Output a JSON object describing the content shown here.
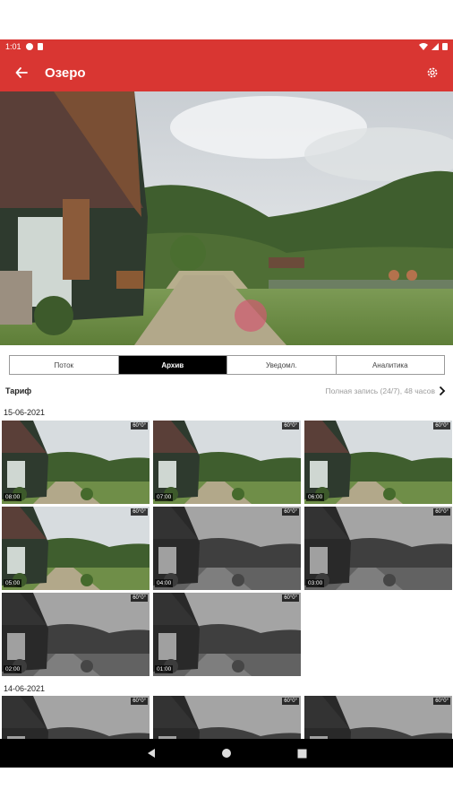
{
  "status_bar": {
    "time": "1:01"
  },
  "app_bar": {
    "title": "Озеро"
  },
  "tabs": [
    {
      "label": "Поток",
      "active": false
    },
    {
      "label": "Архив",
      "active": true
    },
    {
      "label": "Уведомл.",
      "active": false
    },
    {
      "label": "Аналитика",
      "active": false
    }
  ],
  "tariff": {
    "label": "Тариф",
    "value": "Полная запись (24/7), 48 часов"
  },
  "groups": [
    {
      "date": "15-06-2021",
      "thumbs": [
        {
          "time": "08:00",
          "badge": "60°0°",
          "night": false
        },
        {
          "time": "07:00",
          "badge": "60°0°",
          "night": false
        },
        {
          "time": "06:00",
          "badge": "60°0°",
          "night": false
        },
        {
          "time": "05:00",
          "badge": "60°0°",
          "night": false
        },
        {
          "time": "04:00",
          "badge": "60°0°",
          "night": true
        },
        {
          "time": "03:00",
          "badge": "60°0°",
          "night": true
        },
        {
          "time": "02:00",
          "badge": "60°0°",
          "night": true
        },
        {
          "time": "01:00",
          "badge": "60°0°",
          "night": true
        }
      ]
    },
    {
      "date": "14-06-2021",
      "thumbs": [
        {
          "time": "",
          "badge": "60°0°",
          "night": true
        },
        {
          "time": "",
          "badge": "60°0°",
          "night": true
        },
        {
          "time": "",
          "badge": "60°0°",
          "night": true
        }
      ]
    }
  ],
  "colors": {
    "accent": "#d93632",
    "tab_active_bg": "#000000"
  },
  "icons": {
    "back": "arrow-left-icon",
    "settings": "gear-icon",
    "chevron": "chevron-right-icon"
  }
}
